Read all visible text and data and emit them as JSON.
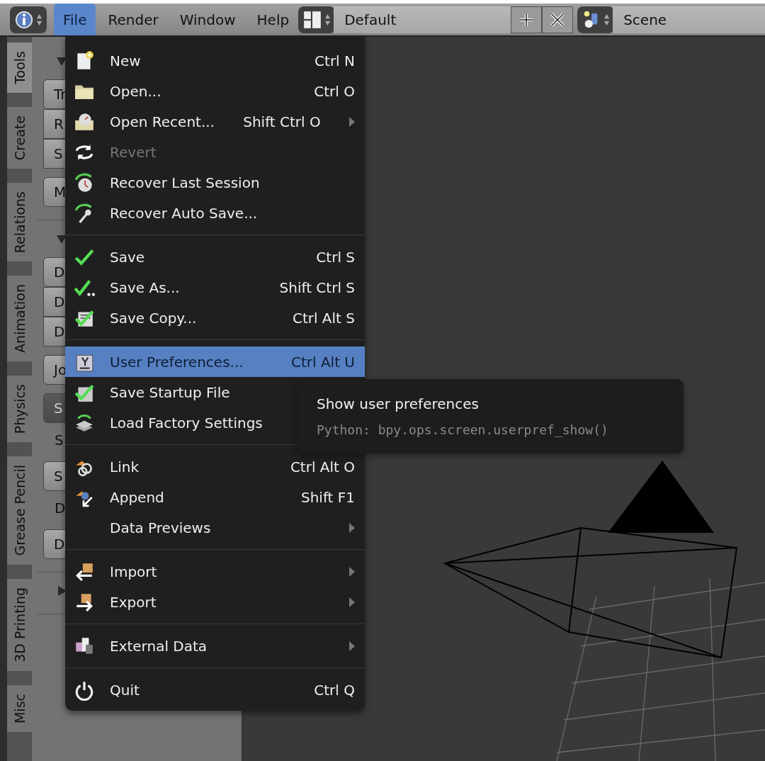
{
  "top_bar": {
    "menus": [
      {
        "label": "File",
        "selected": true
      },
      {
        "label": "Render",
        "selected": false
      },
      {
        "label": "Window",
        "selected": false
      },
      {
        "label": "Help",
        "selected": false
      }
    ],
    "layout_field": {
      "value": "Default"
    },
    "scene_field": {
      "value": "Scene"
    }
  },
  "tool_shelf": {
    "tabs": [
      {
        "label": "Tools",
        "selected": true
      },
      {
        "label": "Create",
        "selected": false
      },
      {
        "label": "Relations",
        "selected": false
      },
      {
        "label": "Animation",
        "selected": false
      },
      {
        "label": "Physics",
        "selected": false
      },
      {
        "label": "Grease Pencil",
        "selected": false
      },
      {
        "label": "3D Printing",
        "selected": false
      },
      {
        "label": "Misc",
        "selected": false
      }
    ],
    "panels": [
      {
        "expanded": true,
        "groups": [
          [
            {
              "kind": "button",
              "label": "Tr"
            },
            {
              "kind": "button",
              "label": "R"
            },
            {
              "kind": "button",
              "label": "S"
            }
          ],
          [
            {
              "kind": "button",
              "label": "M"
            }
          ]
        ]
      },
      {
        "expanded": true,
        "groups": [
          [
            {
              "kind": "button",
              "label": "D"
            },
            {
              "kind": "button",
              "label": "D"
            },
            {
              "kind": "button",
              "label": "D"
            }
          ],
          [
            {
              "kind": "button",
              "label": "Jo"
            }
          ],
          [
            {
              "kind": "dropdown",
              "label": "S"
            }
          ],
          [
            {
              "kind": "label",
              "label": "S"
            }
          ],
          [
            {
              "kind": "button",
              "label": "S"
            }
          ],
          [
            {
              "kind": "label",
              "label": "D"
            }
          ],
          [
            {
              "kind": "button",
              "label": "D"
            }
          ]
        ]
      },
      {
        "expanded": false
      }
    ]
  },
  "file_menu": {
    "sections": [
      [
        {
          "label": "New",
          "shortcut": "Ctrl N",
          "submenu": false,
          "disabled": false,
          "selected": false
        },
        {
          "label": "Open...",
          "shortcut": "Ctrl O",
          "submenu": false,
          "disabled": false,
          "selected": false
        },
        {
          "label": "Open Recent...",
          "shortcut": "Shift Ctrl O",
          "submenu": true,
          "disabled": false,
          "selected": false
        },
        {
          "label": "Revert",
          "submenu": false,
          "disabled": true,
          "selected": false
        },
        {
          "label": "Recover Last Session",
          "submenu": false,
          "disabled": false,
          "selected": false
        },
        {
          "label": "Recover Auto Save...",
          "submenu": false,
          "disabled": false,
          "selected": false
        }
      ],
      [
        {
          "label": "Save",
          "shortcut": "Ctrl S",
          "submenu": false,
          "disabled": false,
          "selected": false
        },
        {
          "label": "Save As...",
          "shortcut": "Shift Ctrl S",
          "submenu": false,
          "disabled": false,
          "selected": false
        },
        {
          "label": "Save Copy...",
          "shortcut": "Ctrl Alt S",
          "submenu": false,
          "disabled": false,
          "selected": false
        }
      ],
      [
        {
          "label": "User Preferences...",
          "shortcut": "Ctrl Alt U",
          "submenu": false,
          "disabled": false,
          "selected": true
        },
        {
          "label": "Save Startup File",
          "submenu": false,
          "disabled": false,
          "selected": false
        },
        {
          "label": "Load Factory Settings",
          "submenu": false,
          "disabled": false,
          "selected": false
        }
      ],
      [
        {
          "label": "Link",
          "shortcut": "Ctrl Alt O",
          "submenu": false,
          "disabled": false,
          "selected": false
        },
        {
          "label": "Append",
          "shortcut": "Shift F1",
          "submenu": false,
          "disabled": false,
          "selected": false
        },
        {
          "label": "Data Previews",
          "submenu": true,
          "disabled": false,
          "selected": false
        }
      ],
      [
        {
          "label": "Import",
          "submenu": true,
          "disabled": false,
          "selected": false
        },
        {
          "label": "Export",
          "submenu": true,
          "disabled": false,
          "selected": false
        }
      ],
      [
        {
          "label": "External Data",
          "submenu": true,
          "disabled": false,
          "selected": false
        }
      ],
      [
        {
          "label": "Quit",
          "shortcut": "Ctrl Q",
          "submenu": false,
          "disabled": false,
          "selected": false
        }
      ]
    ]
  },
  "tooltip": {
    "title": "Show user preferences",
    "python": "Python: bpy.ops.screen.userpref_show()"
  }
}
